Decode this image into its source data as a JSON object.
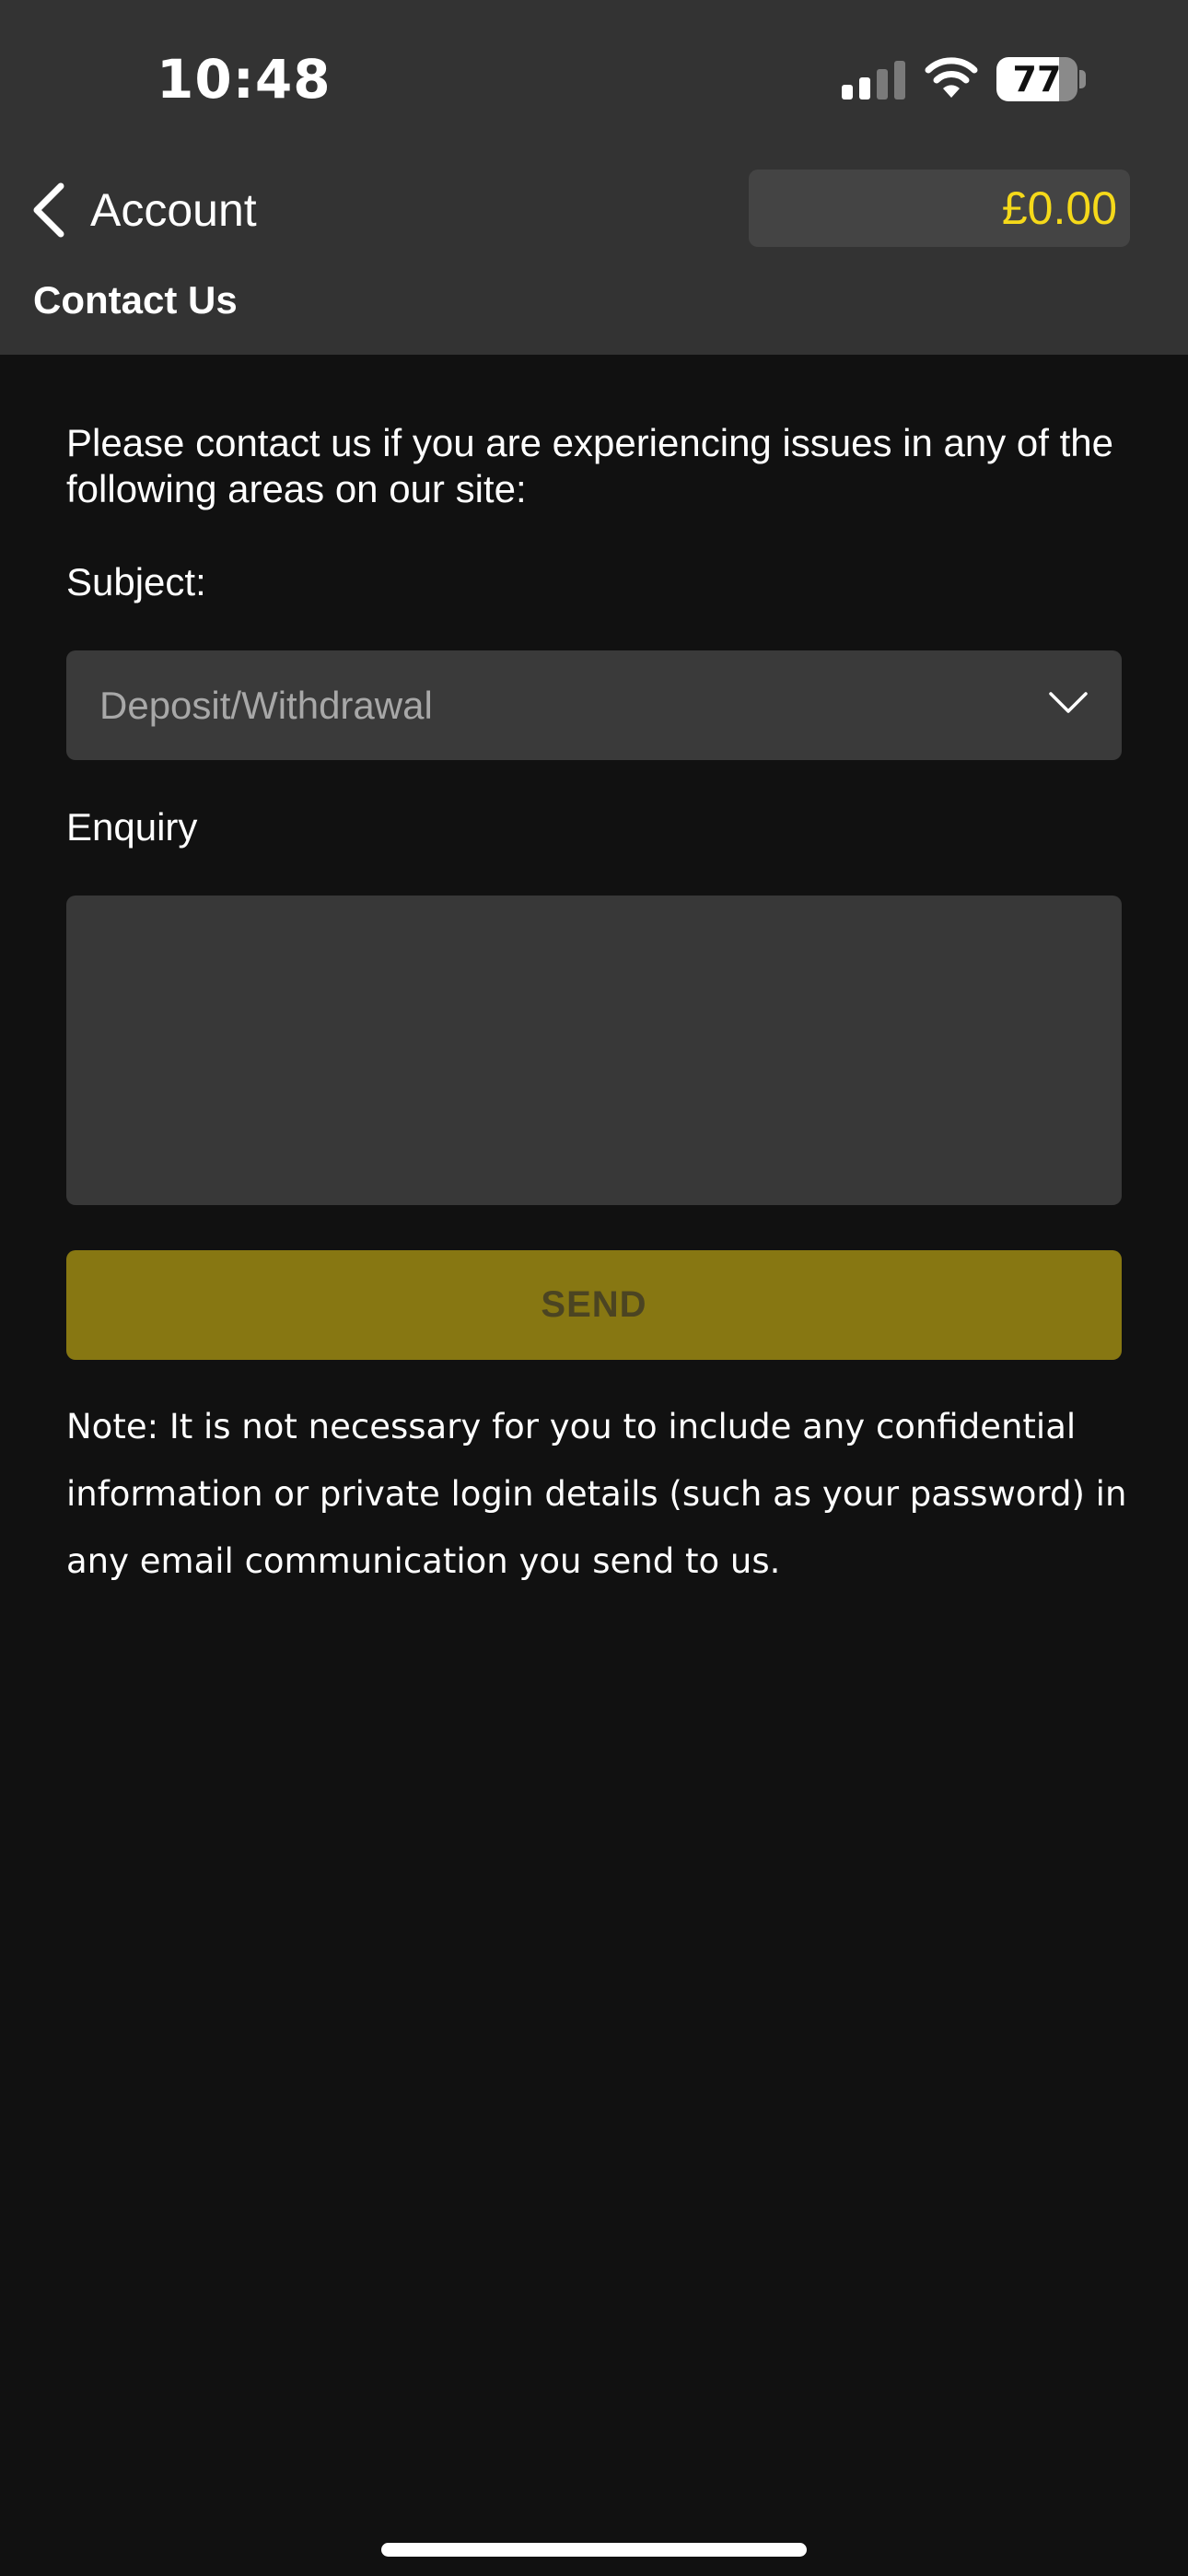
{
  "status_bar": {
    "time": "10:48",
    "battery": "77",
    "battery_level": 0.77,
    "signal_bars_active": 2,
    "signal_bars_total": 4,
    "icons": [
      "cellular-signal-icon",
      "wifi-icon",
      "battery-icon"
    ]
  },
  "header": {
    "back_label": "Account",
    "back_icon": "chevron-left-icon",
    "balance": "£0.00",
    "page_title": "Contact Us"
  },
  "form": {
    "intro": "Please contact us if you are experiencing issues in any of the following areas on our site:",
    "subject_label": "Subject:",
    "subject_value": "Deposit/Withdrawal",
    "subject_icon": "chevron-down-icon",
    "enquiry_label": "Enquiry",
    "enquiry_value": "",
    "send_label": "SEND",
    "note": "Note: It is not necessary for you to include any confidential information or private login details (such as your password) in any email communication you send to us."
  },
  "colors": {
    "header_bg": "#333333",
    "page_bg": "#111111",
    "balance_text": "#f5d91a",
    "send_button_bg": "#877712",
    "send_button_text": "#4b4422"
  }
}
